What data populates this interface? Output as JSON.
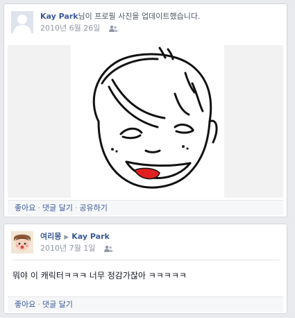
{
  "posts": [
    {
      "actor": "Kay Park",
      "action": "님이 프로필 사진을 업데이트했습니다.",
      "date": "2010년 6월 26일",
      "audience_icon": "people-icon",
      "footer": {
        "like": "좋아요",
        "comment": "댓글 달기",
        "share": "공유하기"
      }
    },
    {
      "actor": "여리몽",
      "target": "Kay Park",
      "date": "2010년 7월 1일",
      "audience_icon": "people-icon",
      "text": "뭐야 이 캐릭터ㅋㅋㅋ 너무 정감가잖아 ㅋㅋㅋㅋㅋ",
      "footer": {
        "like": "좋아요",
        "comment": "댓글 달기"
      }
    }
  ],
  "separator": "·",
  "colors": {
    "link": "#3b5998",
    "meta": "#9197a3",
    "background": "#e9eaed",
    "lips": "#e02020"
  }
}
